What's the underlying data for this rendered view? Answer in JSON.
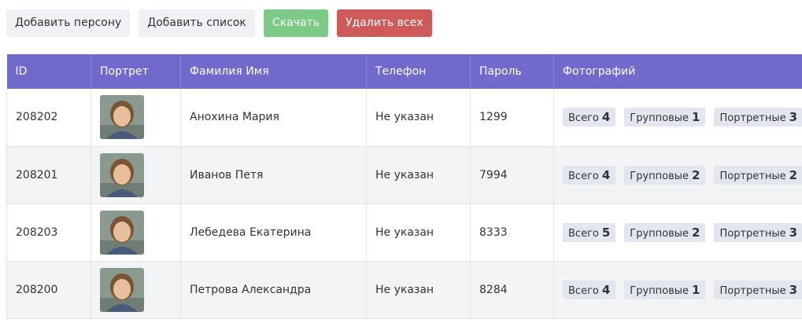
{
  "toolbar": {
    "add_person": "Добавить персону",
    "add_list": "Добавить список",
    "download": "Скачать",
    "delete_all": "Удалить всех"
  },
  "colors": {
    "header": "#7169cb",
    "download": "#7dc986",
    "delete": "#cf5a5a",
    "badge": "#e2e7ef"
  },
  "table": {
    "headers": {
      "id": "ID",
      "portrait": "Портрет",
      "name": "Фамилия Имя",
      "phone": "Телефон",
      "password": "Пароль",
      "photos": "Фотографий"
    },
    "badge_labels": {
      "total": "Всего",
      "group": "Групповые",
      "portrait": "Портретные"
    },
    "rows": [
      {
        "id": "208202",
        "name": "Анохина Мария",
        "phone": "Не указан",
        "password": "1299",
        "total": "4",
        "group": "1",
        "portrait": "3"
      },
      {
        "id": "208201",
        "name": "Иванов Петя",
        "phone": "Не указан",
        "password": "7994",
        "total": "4",
        "group": "2",
        "portrait": "2"
      },
      {
        "id": "208203",
        "name": "Лебедева Екатерина",
        "phone": "Не указан",
        "password": "8333",
        "total": "5",
        "group": "2",
        "portrait": "3"
      },
      {
        "id": "208200",
        "name": "Петрова Александра",
        "phone": "Не указан",
        "password": "8284",
        "total": "4",
        "group": "1",
        "portrait": "3"
      }
    ]
  }
}
